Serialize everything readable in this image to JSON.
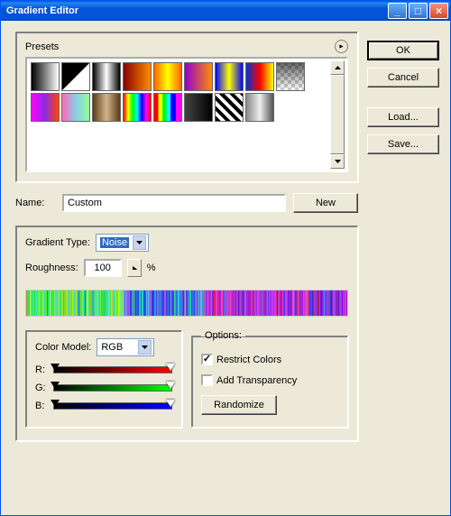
{
  "window": {
    "title": "Gradient Editor"
  },
  "buttons": {
    "ok": "OK",
    "cancel": "Cancel",
    "load": "Load...",
    "save": "Save...",
    "new": "New",
    "randomize": "Randomize"
  },
  "presets": {
    "label": "Presets"
  },
  "name": {
    "label": "Name:",
    "value": "Custom"
  },
  "gradient_type": {
    "label": "Gradient Type:",
    "value": "Noise"
  },
  "roughness": {
    "label": "Roughness:",
    "value": "100",
    "suffix": "%"
  },
  "color_model": {
    "label": "Color Model:",
    "value": "RGB",
    "channels": [
      "R:",
      "G:",
      "B:"
    ]
  },
  "options": {
    "label": "Options:",
    "restrict": {
      "label": "Restrict Colors",
      "checked": true
    },
    "transparency": {
      "label": "Add Transparency",
      "checked": false
    }
  },
  "preset_gradients": [
    "linear-gradient(to right,#000,#fff)",
    "linear-gradient(135deg,#000 0%,#000 49%,#fff 51%,#fff 100%),repeating-conic-gradient(#ccc 0 25%,#fff 0 50%) 0/8px 8px",
    "linear-gradient(to right,#000,#fff,#000)",
    "linear-gradient(to right,#8B0000,#FF8C00)",
    "linear-gradient(to right,#FF6600,#FFFF00,#FF6600)",
    "linear-gradient(to right,#9400D3,#FF8C00)",
    "linear-gradient(to right,#0000FF,#FFFF00,#0000FF)",
    "linear-gradient(to right,#0033CC,#FF0000,#FFFF00)",
    "linear-gradient(to bottom,rgba(0,0,0,0.6),rgba(0,0,0,0)),repeating-conic-gradient(#ccc 0 25%,#fff 0 50%) 0/8px 8px",
    "linear-gradient(to right,#FF00FF,#8A2BE2,#FF4500)",
    "linear-gradient(to right,#FF69B4,#87CEEB,#98FB98)",
    "linear-gradient(to right,#5B3A1A,#D2B48C,#5B3A1A)",
    "linear-gradient(to right,#FF0000,#FFFF00,#00FF00,#00FFFF,#0000FF,#FF00FF,#FF0000)",
    "linear-gradient(to right,#FF0000 15%,#FFFF00 15% 30%,#00FF00 30% 45%,#00FFFF 45% 60%,#0000FF 60% 80%,#FF00FF 80%)",
    "linear-gradient(to right,#444,#000)",
    "repeating-linear-gradient(45deg,#000 0 4px,#fff 4px 8px)",
    "linear-gradient(to right,#888,#eee,#555)"
  ]
}
